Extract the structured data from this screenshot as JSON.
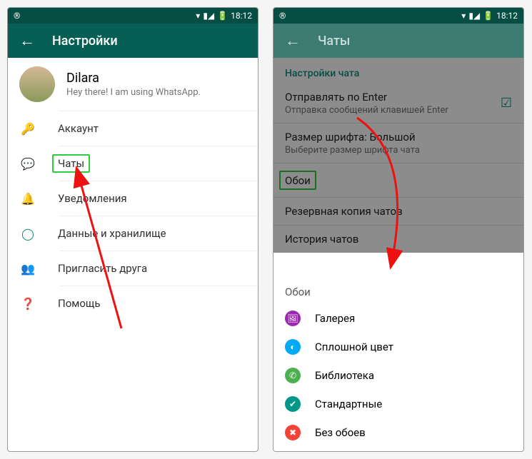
{
  "status": {
    "time": "18:12"
  },
  "left": {
    "appbar_title": "Настройки",
    "profile": {
      "name": "Dilara",
      "status": "Hey there! I am using WhatsApp."
    },
    "menu": {
      "account": "Аккаунт",
      "chats": "Чаты",
      "notifications": "Уведомления",
      "data": "Данные и хранилище",
      "invite": "Пригласить друга",
      "help": "Помощь"
    }
  },
  "right": {
    "appbar_title": "Чаты",
    "section": "Настройки чата",
    "enter": {
      "title": "Отправлять по Enter",
      "sub": "Отправка сообщений клавишей Enter"
    },
    "font": {
      "title": "Размер шрифта: Большой",
      "sub": "Выберите размер шрифта чата"
    },
    "wallpaper": "Обои",
    "backup": "Резервная копия чатов",
    "history": "История чатов",
    "sheet": {
      "title": "Обои",
      "gallery": "Галерея",
      "solid": "Сплошной цвет",
      "library": "Библиотека",
      "default": "Стандартные",
      "none": "Без обоев"
    }
  },
  "colors": {
    "gallery": "#9c27b0",
    "solid": "#03a9f4",
    "library": "#4caf50",
    "default": "#009688",
    "none": "#f44336"
  }
}
